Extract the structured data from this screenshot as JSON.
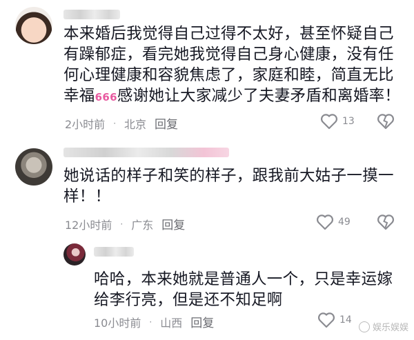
{
  "comments": [
    {
      "text_lines": [
        "本来婚后我觉得自己过得不太好，甚至怀疑自己",
        "有躁郁症，看完她我觉得自己身心健康，没有任",
        "何心理健康和容貌焦虑了，家庭和睦，简直无比",
        "幸福666感谢她让大家减少了夫妻矛盾和离婚率！"
      ],
      "time": "2小时前",
      "location": "北京",
      "reply_label": "回复",
      "like_count": "13"
    },
    {
      "text_lines": [
        "她说话的样子和笑的样子，跟我前大姑子一摸一",
        "样！！"
      ],
      "time": "12小时前",
      "location": "广东",
      "reply_label": "回复",
      "like_count": "49"
    },
    {
      "text_lines": [
        "哈哈，本来她就是普通人一个，只是幸运嫁",
        "给李行亮，但是还不知足啊"
      ],
      "time": "10小时前",
      "location": "山西",
      "reply_label": "回复",
      "like_count": "14"
    }
  ],
  "separator": "·",
  "icons": [
    "heart-outline-icon",
    "broken-heart-icon"
  ],
  "watermark": "娱乐娱娱",
  "colors": {
    "text": "#161823",
    "meta": "#8a8b91",
    "accent_666": "#e85aa0"
  }
}
